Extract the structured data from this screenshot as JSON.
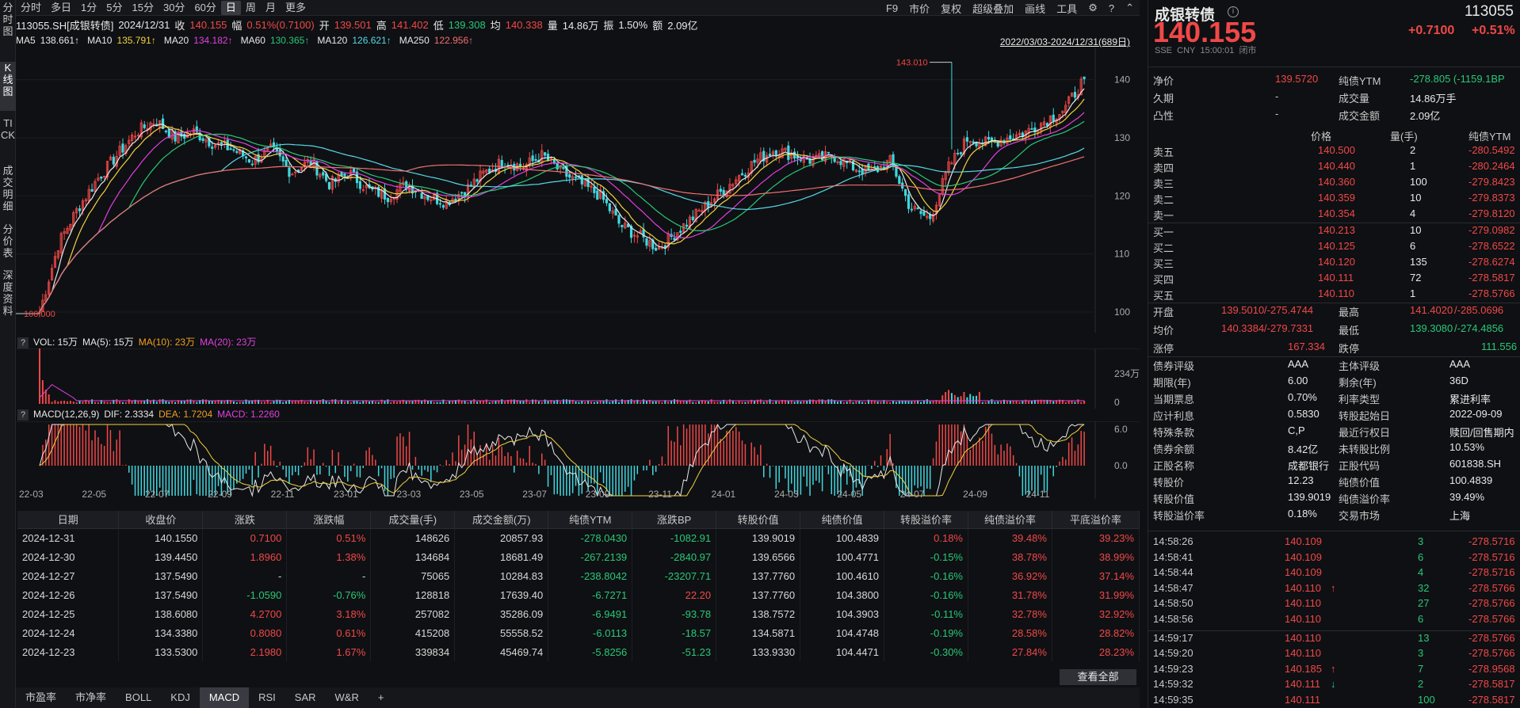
{
  "top_periods": [
    "分时",
    "多日",
    "1分",
    "5分",
    "15分",
    "30分",
    "60分",
    "日",
    "周",
    "月",
    "更多"
  ],
  "active_period": "日",
  "top_tools": [
    "F9",
    "市价",
    "复权",
    "超级叠加",
    "画线",
    "工具"
  ],
  "left_tabs": [
    "分时图",
    "K线图",
    "TICK",
    "成交明细",
    "分价表",
    "深度资料"
  ],
  "info": {
    "code": "113055.SH[成银转债]",
    "date": "2024/12/31",
    "close_l": "收",
    "close": "140.155",
    "chg_l": "幅",
    "chg": "0.51%(0.7100)",
    "open_l": "开",
    "open": "139.501",
    "high_l": "高",
    "high": "141.402",
    "low_l": "低",
    "low": "139.308",
    "avg_l": "均",
    "avg": "140.338",
    "vol_l": "量",
    "vol": "14.86万",
    "amp_l": "振",
    "amp": "1.50%",
    "amt_l": "额",
    "amt": "2.09亿"
  },
  "ma": [
    {
      "label": "MA5",
      "value": "138.661↑",
      "color": "#e8e8e8"
    },
    {
      "label": "MA10",
      "value": "135.791↑",
      "color": "#f2d240"
    },
    {
      "label": "MA20",
      "value": "134.182↑",
      "color": "#e040e0"
    },
    {
      "label": "MA60",
      "value": "130.365↑",
      "color": "#28c878"
    },
    {
      "label": "MA120",
      "value": "126.621↑",
      "color": "#56d8e8"
    },
    {
      "label": "MA250",
      "value": "122.956↑",
      "color": "#f07070"
    }
  ],
  "date_range": "2022/03/03-2024/12/31(689日)",
  "chart_data": {
    "type": "candlestick",
    "y_ticks": [
      140,
      130,
      120,
      110,
      100
    ],
    "ylim": [
      97,
      145
    ],
    "max_label": "143.010",
    "min_label": "100.000",
    "x_ticks": [
      "22-03",
      "22-05",
      "22-07",
      "22-09",
      "22-11",
      "23-01",
      "23-03",
      "23-05",
      "23-07",
      "23-09",
      "23-11",
      "24-01",
      "24-03",
      "24-05",
      "24-07",
      "24-09",
      "24-11"
    ],
    "close_curve": [
      100,
      112,
      118,
      123,
      127,
      131,
      133,
      130,
      131,
      129,
      128,
      126,
      128,
      124,
      126,
      122,
      124,
      121,
      120,
      122,
      120,
      119,
      121,
      124,
      126,
      125,
      127,
      124,
      122,
      120,
      115,
      113,
      111,
      114,
      117,
      120,
      123,
      126,
      128,
      127,
      126,
      127,
      125,
      124,
      126,
      118,
      116,
      125,
      130,
      129,
      130,
      131,
      133,
      135,
      140.155
    ],
    "vol_ticks": [
      "234万",
      "0"
    ],
    "macd_ticks": [
      "6.0",
      "0.0"
    ]
  },
  "vol_panel": {
    "q": "?",
    "label": "VOL: 15万",
    "ma5": "MA(5): 15万",
    "ma10": "MA(10): 23万",
    "ma20": "MA(20): 23万"
  },
  "macd_panel": {
    "q": "?",
    "label": "MACD(12,26,9)",
    "dif": "DIF: 2.3334",
    "dea": "DEA: 1.7204",
    "macd": "MACD: 1.2260"
  },
  "table": {
    "headers": [
      "日期",
      "收盘价",
      "涨跌",
      "涨跌幅",
      "成交量(手)",
      "成交金额(万)",
      "纯债YTM",
      "涨跌BP",
      "转股价值",
      "纯债价值",
      "转股溢价率",
      "纯债溢价率",
      "平底溢价率"
    ],
    "rows": [
      [
        "2024-12-31",
        "140.1550",
        "0.7100",
        "0.51%",
        "148626",
        "20857.93",
        "-278.0430",
        "-1082.91",
        "139.9019",
        "100.4839",
        "0.18%",
        "39.48%",
        "39.23%"
      ],
      [
        "2024-12-30",
        "139.4450",
        "1.8960",
        "1.38%",
        "134684",
        "18681.49",
        "-267.2139",
        "-2840.97",
        "139.6566",
        "100.4771",
        "-0.15%",
        "38.78%",
        "38.99%"
      ],
      [
        "2024-12-27",
        "137.5490",
        "-",
        "-",
        "75065",
        "10284.83",
        "-238.8042",
        "-23207.71",
        "137.7760",
        "100.4610",
        "-0.16%",
        "36.92%",
        "37.14%"
      ],
      [
        "2024-12-26",
        "137.5490",
        "-1.0590",
        "-0.76%",
        "128818",
        "17639.40",
        "-6.7271",
        "22.20",
        "137.7760",
        "104.3800",
        "-0.16%",
        "31.78%",
        "31.99%"
      ],
      [
        "2024-12-25",
        "138.6080",
        "4.2700",
        "3.18%",
        "257082",
        "35286.09",
        "-6.9491",
        "-93.78",
        "138.7572",
        "104.3903",
        "-0.11%",
        "32.78%",
        "32.92%"
      ],
      [
        "2024-12-24",
        "134.3380",
        "0.8080",
        "0.61%",
        "415208",
        "55558.52",
        "-6.0113",
        "-18.57",
        "134.5871",
        "104.4748",
        "-0.19%",
        "28.58%",
        "28.82%"
      ],
      [
        "2024-12-23",
        "133.5300",
        "2.1980",
        "1.67%",
        "339834",
        "45469.74",
        "-5.8256",
        "-51.23",
        "133.9330",
        "104.4471",
        "-0.30%",
        "27.84%",
        "28.23%"
      ]
    ]
  },
  "view_all": "查看全部",
  "bottom_tabs": [
    "市盈率",
    "市净率",
    "BOLL",
    "KDJ",
    "MACD",
    "RSI",
    "SAR",
    "W&R",
    "+"
  ],
  "active_bottom_tab": "MACD",
  "rp": {
    "name": "成银转债",
    "code": "113055",
    "price": "140.155",
    "change": "+0.7100",
    "pct": "+0.51%",
    "exch": "SSE",
    "cur": "CNY",
    "time": "15:00:01",
    "status": "闭市",
    "stats1": [
      [
        "净价",
        "139.5720",
        "纯债YTM",
        "-278.805 (-1159.1BP"
      ],
      [
        "久期",
        "-",
        "成交量",
        "14.86万手"
      ],
      [
        "凸性",
        "-",
        "成交金额",
        "2.09亿"
      ]
    ],
    "ob_header": [
      "价格",
      "量(手)",
      "纯债YTM"
    ],
    "asks": [
      [
        "卖五",
        "140.500",
        "2",
        "-280.5492"
      ],
      [
        "卖四",
        "140.440",
        "1",
        "-280.2464"
      ],
      [
        "卖三",
        "140.360",
        "100",
        "-279.8423"
      ],
      [
        "卖二",
        "140.359",
        "10",
        "-279.8373"
      ],
      [
        "卖一",
        "140.354",
        "4",
        "-279.8120"
      ]
    ],
    "bids": [
      [
        "买一",
        "140.213",
        "10",
        "-279.0982"
      ],
      [
        "买二",
        "140.125",
        "6",
        "-278.6522"
      ],
      [
        "买三",
        "140.120",
        "135",
        "-278.6274"
      ],
      [
        "买四",
        "140.111",
        "72",
        "-278.5817"
      ],
      [
        "买五",
        "140.110",
        "1",
        "-278.5766"
      ]
    ],
    "ohl": [
      [
        "开盘",
        "139.5010",
        "/-275.4744",
        "最高",
        "141.4020",
        "/-285.0696"
      ],
      [
        "均价",
        "140.3384",
        "/-279.7331",
        "最低",
        "139.3080",
        "/-274.4856"
      ]
    ],
    "limits": [
      "涨停",
      "167.334",
      "跌停",
      "111.556"
    ],
    "info": [
      [
        "债券评级",
        "AAA",
        "主体评级",
        "AAA"
      ],
      [
        "期限(年)",
        "6.00",
        "剩余(年)",
        "36D"
      ],
      [
        "当期票息",
        "0.70%",
        "利率类型",
        "累进利率"
      ],
      [
        "应计利息",
        "0.5830",
        "转股起始日",
        "2022-09-09"
      ],
      [
        "特殊条款",
        "C,P",
        "最近行权日",
        "赎回/回售期内"
      ],
      [
        "债券余额",
        "8.42亿",
        "未转股比例",
        "10.53%"
      ],
      [
        "正股名称",
        "成都银行",
        "正股代码",
        "601838.SH"
      ],
      [
        "转股价",
        "12.23",
        "纯债价值",
        "100.4839"
      ],
      [
        "转股价值",
        "139.9019",
        "纯债溢价率",
        "39.49%"
      ],
      [
        "转股溢价率",
        "0.18%",
        "交易市场",
        "上海"
      ]
    ],
    "ticks": [
      [
        "14:58:26",
        "140.109",
        "",
        "3",
        "-278.5716"
      ],
      [
        "14:58:41",
        "140.109",
        "",
        "6",
        "-278.5716"
      ],
      [
        "14:58:44",
        "140.109",
        "",
        "4",
        "-278.5716"
      ],
      [
        "14:58:47",
        "140.110",
        "↑",
        "32",
        "-278.5766"
      ],
      [
        "14:58:50",
        "140.110",
        "",
        "27",
        "-278.5766"
      ],
      [
        "14:58:56",
        "140.110",
        "",
        "6",
        "-278.5766"
      ],
      [
        "14:59:17",
        "140.110",
        "",
        "13",
        "-278.5766"
      ],
      [
        "14:59:20",
        "140.110",
        "",
        "3",
        "-278.5766"
      ],
      [
        "14:59:23",
        "140.185",
        "↑",
        "7",
        "-278.9568"
      ],
      [
        "14:59:32",
        "140.111",
        "↓",
        "2",
        "-278.5817"
      ],
      [
        "14:59:35",
        "140.111",
        "",
        "100",
        "-278.5817"
      ]
    ]
  }
}
